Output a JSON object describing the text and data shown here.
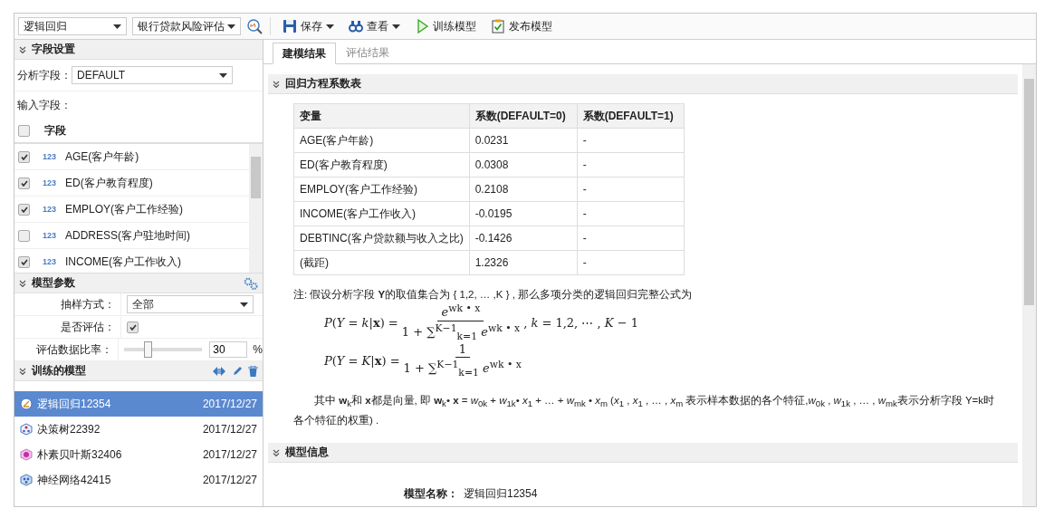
{
  "toolbar": {
    "model_type": "逻辑回归",
    "dataset": "银行贷款风险评估",
    "buttons": [
      {
        "kind": "save",
        "label": "保存",
        "dropdown": true
      },
      {
        "kind": "view",
        "label": "查看",
        "dropdown": true
      },
      {
        "kind": "train",
        "label": "训练模型",
        "dropdown": false
      },
      {
        "kind": "publish",
        "label": "发布模型",
        "dropdown": false
      }
    ]
  },
  "field_settings": {
    "title": "字段设置",
    "analysis_label": "分析字段：",
    "analysis_value": "DEFAULT",
    "input_label": "输入字段：",
    "header_label": "字段",
    "header_checked": false,
    "items": [
      {
        "type_badge": "123",
        "name": "AGE(客户年龄)",
        "checked": true
      },
      {
        "type_badge": "123",
        "name": "ED(客户教育程度)",
        "checked": true
      },
      {
        "type_badge": "123",
        "name": "EMPLOY(客户工作经验)",
        "checked": true
      },
      {
        "type_badge": "123",
        "name": "ADDRESS(客户驻地时间)",
        "checked": false
      },
      {
        "type_badge": "123",
        "name": "INCOME(客户工作收入)",
        "checked": true
      }
    ]
  },
  "model_params": {
    "title": "模型参数",
    "rows": [
      {
        "kind": "select",
        "label": "抽样方式：",
        "value": "全部"
      },
      {
        "kind": "checkbox",
        "label": "是否评估：",
        "checked": true
      },
      {
        "kind": "slider",
        "label": "评估数据比率：",
        "level": 0.3,
        "value": "30",
        "unit": "%"
      }
    ]
  },
  "trained_models": {
    "title": "训练的模型",
    "items": [
      {
        "kind": "logistic",
        "name": "逻辑回归12354",
        "date": "2017/12/27",
        "selected": true
      },
      {
        "kind": "tree",
        "name": "决策树22392",
        "date": "2017/12/27",
        "selected": false
      },
      {
        "kind": "bayes",
        "name": "朴素贝叶斯32406",
        "date": "2017/12/27",
        "selected": false
      },
      {
        "kind": "neural",
        "name": "神经网络42415",
        "date": "2017/12/27",
        "selected": false
      }
    ]
  },
  "tabs": [
    {
      "label": "建模结果",
      "selected": true
    },
    {
      "label": "评估结果",
      "selected": false
    }
  ],
  "coef_section": {
    "title": "回归方程系数表",
    "columns": [
      "变量",
      "系数(DEFAULT=0)",
      "系数(DEFAULT=1)"
    ],
    "rows": [
      [
        "AGE(客户年龄)",
        "0.0231",
        "-"
      ],
      [
        "ED(客户教育程度)",
        "0.0308",
        "-"
      ],
      [
        "EMPLOY(客户工作经验)",
        "0.2108",
        "-"
      ],
      [
        "INCOME(客户工作收入)",
        "-0.0195",
        "-"
      ],
      [
        "DEBTINC(客户贷款额与收入之比)",
        "-0.1426",
        "-"
      ],
      [
        "(截距)",
        "1.2326",
        "-"
      ]
    ],
    "note": "注: 假设分析字段 **Y**的取值集合为 { 1,2, … ,K } , 那么多项分类的逻辑回归完整公式为",
    "formulas": [
      {
        "lhs": "*P*(*Y* = *k*|**x**) =",
        "numerator": "*e*$^{wk • x}$",
        "denominator": "1 + ∑$^{K−1}$$_{k=1}$ *e*$^{wk • x}$",
        "tail": ", *k* = 1,2, ⋯ , *K* − 1"
      },
      {
        "lhs": "*P*(*Y* = *K*|**x**) =",
        "numerator": "1",
        "denominator": "1 + ∑$^{K−1}$$_{k=1}$ *e*$^{wk • x}$"
      }
    ],
    "explanation": "其中 **w**$_{k}$和 **x**都是向量, 即 **w**$_{k}$• **x** = *w*$_{0k}$ + *w*$_{1k}$• *x*$_{1}$ + … + *w*$_{mk}$ • *x*$_{m}$ (*x*$_{1}$ , *x*$_{1}$ , … , *x*$_{m}$ 表示样本数据的各个特征,*w*$_{0k}$ , *w*$_{1k}$ , … , *w*$_{mk}$表示分析字段 Y=k时各个特征的权重) ."
  },
  "info_section": {
    "title": "模型信息",
    "model_name_label": "模型名称：",
    "model_name_value": "逻辑回归12354"
  }
}
